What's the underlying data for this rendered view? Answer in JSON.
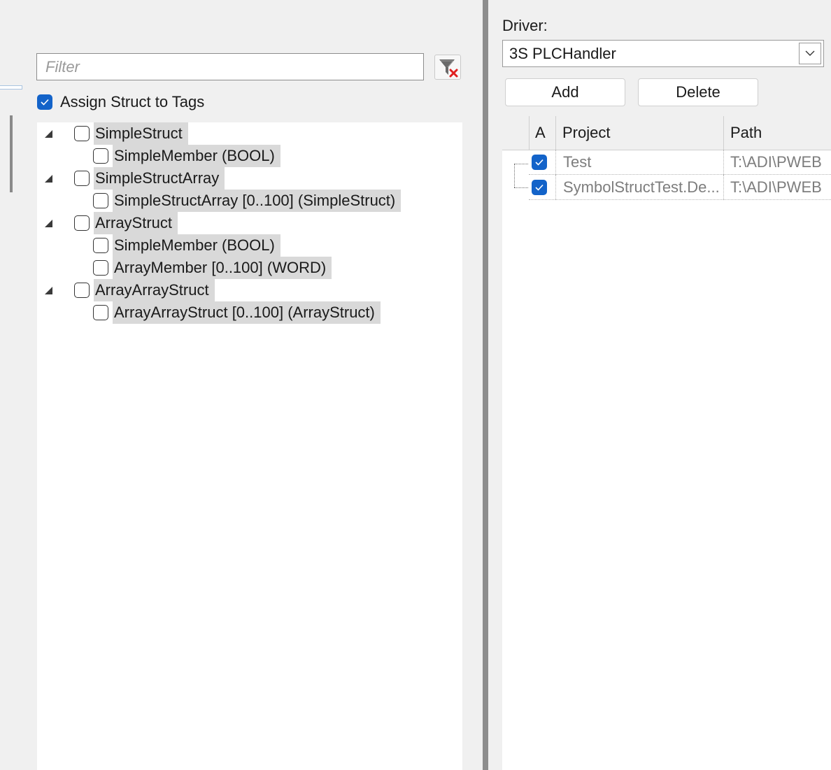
{
  "filter": {
    "placeholder": "Filter",
    "value": ""
  },
  "icons": {
    "filter_clear": "filter-clear-icon",
    "check": "check-icon",
    "expander": "expander-triangle-icon",
    "dropdown": "chevron-down-icon"
  },
  "assign_struct": {
    "label": "Assign Struct to Tags",
    "checked": true
  },
  "tree": {
    "nodes": [
      {
        "label": "SimpleStruct",
        "level": 0,
        "checked": false
      },
      {
        "label": "SimpleMember (BOOL)",
        "level": 1,
        "checked": false
      },
      {
        "label": "SimpleStructArray",
        "level": 0,
        "checked": false
      },
      {
        "label": "SimpleStructArray [0..100] (SimpleStruct)",
        "level": 1,
        "checked": false
      },
      {
        "label": "ArrayStruct",
        "level": 0,
        "checked": false
      },
      {
        "label": "SimpleMember (BOOL)",
        "level": 1,
        "checked": false
      },
      {
        "label": "ArrayMember [0..100] (WORD)",
        "level": 1,
        "checked": false
      },
      {
        "label": "ArrayArrayStruct",
        "level": 0,
        "checked": false
      },
      {
        "label": "ArrayArrayStruct [0..100] (ArrayStruct)",
        "level": 1,
        "checked": false
      }
    ]
  },
  "driver": {
    "label": "Driver:",
    "selected": "3S PLCHandler"
  },
  "buttons": {
    "add": "Add",
    "delete": "Delete"
  },
  "grid": {
    "columns": {
      "a": "A",
      "project": "Project",
      "path": "Path"
    },
    "rows": [
      {
        "checked": true,
        "project": "Test",
        "path": "T:\\ADI\\PWEB"
      },
      {
        "checked": true,
        "project": "SymbolStructTest.De...",
        "path": "T:\\ADI\\PWEB"
      }
    ]
  },
  "colors": {
    "accent": "#1363c9",
    "selection": "#d9d9d9",
    "background": "#f0f0f0",
    "splitter": "#8d8d8d",
    "clear_x": "#e02020"
  }
}
